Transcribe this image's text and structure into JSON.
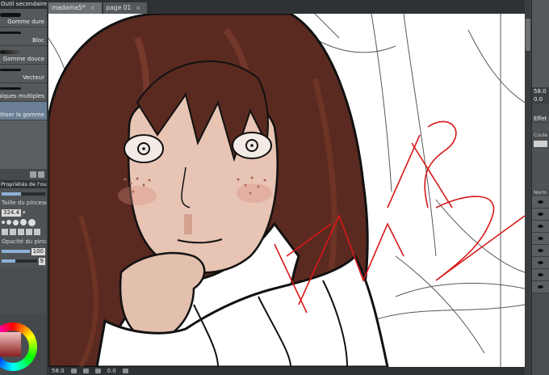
{
  "subtool_panel": {
    "title": "Outil secondaire [Gomme]",
    "items": [
      {
        "label": "Gomme dure",
        "selected": false
      },
      {
        "label": "Bloc",
        "selected": false
      },
      {
        "label": "Gomme douce",
        "selected": false
      },
      {
        "label": "Vecteur",
        "selected": false
      },
      {
        "label": "Calques multiples",
        "selected": false
      },
      {
        "label": "Magnétiser la gomme",
        "selected": true
      }
    ]
  },
  "tool_properties": {
    "title": "Propriétés de l'outil",
    "brush_size_label": "Taille du pinceau",
    "brush_size_value": "324.4",
    "opacity_label": "Opacité du pinceau",
    "opacity_value": "100",
    "stabilization_value": "9"
  },
  "tabs": [
    {
      "label": "madame5*",
      "active": true
    },
    {
      "label": "page 01",
      "active": false
    }
  ],
  "status_bar": {
    "zoom": "58.0",
    "rotation": "0.0"
  },
  "right_panel": {
    "zoom_value": "58.0",
    "rotation_value": "0.0",
    "effect_label": "Effet",
    "color_label": "Coule",
    "normal_label": "Norm"
  },
  "canvas": {
    "watermark": "WIP",
    "colors": {
      "hair": "#5a2a20",
      "skin": "#e8c4b4",
      "wip": "#d81818"
    }
  },
  "colors": {
    "accent": "#6a7f95",
    "chrome": "#4a4d50"
  }
}
